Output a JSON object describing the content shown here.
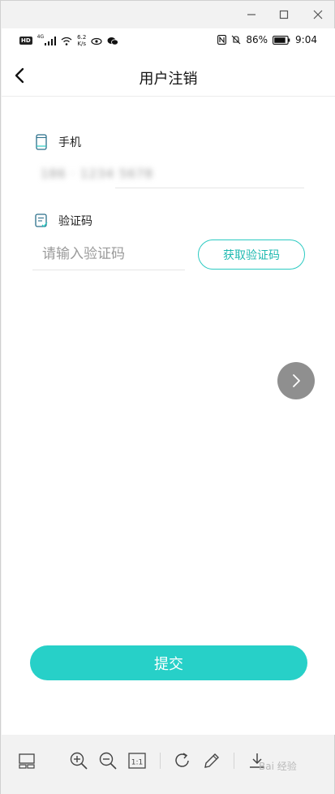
{
  "window": {
    "minimize_icon": "minimize-icon",
    "maximize_icon": "maximize-icon",
    "close_icon": "close-icon"
  },
  "status_bar": {
    "hd": "HD",
    "network": "4G",
    "speed_value": "6.2",
    "speed_unit": "K/s",
    "battery": "86%",
    "time": "9:04"
  },
  "navbar": {
    "title": "用户注销"
  },
  "form": {
    "phone_label": "手机",
    "phone_value": "186 · 1234 5678",
    "code_label": "验证码",
    "code_placeholder": "请输入验证码",
    "get_code_button": "获取验证码",
    "submit_button": "提交"
  },
  "toolbar": {
    "zoom_ratio_label": "1:1",
    "watermark": "Bai 经验"
  },
  "colors": {
    "accent": "#27d0c8",
    "accent_border": "#2ccac2",
    "float_button": "#8f8f8f"
  }
}
